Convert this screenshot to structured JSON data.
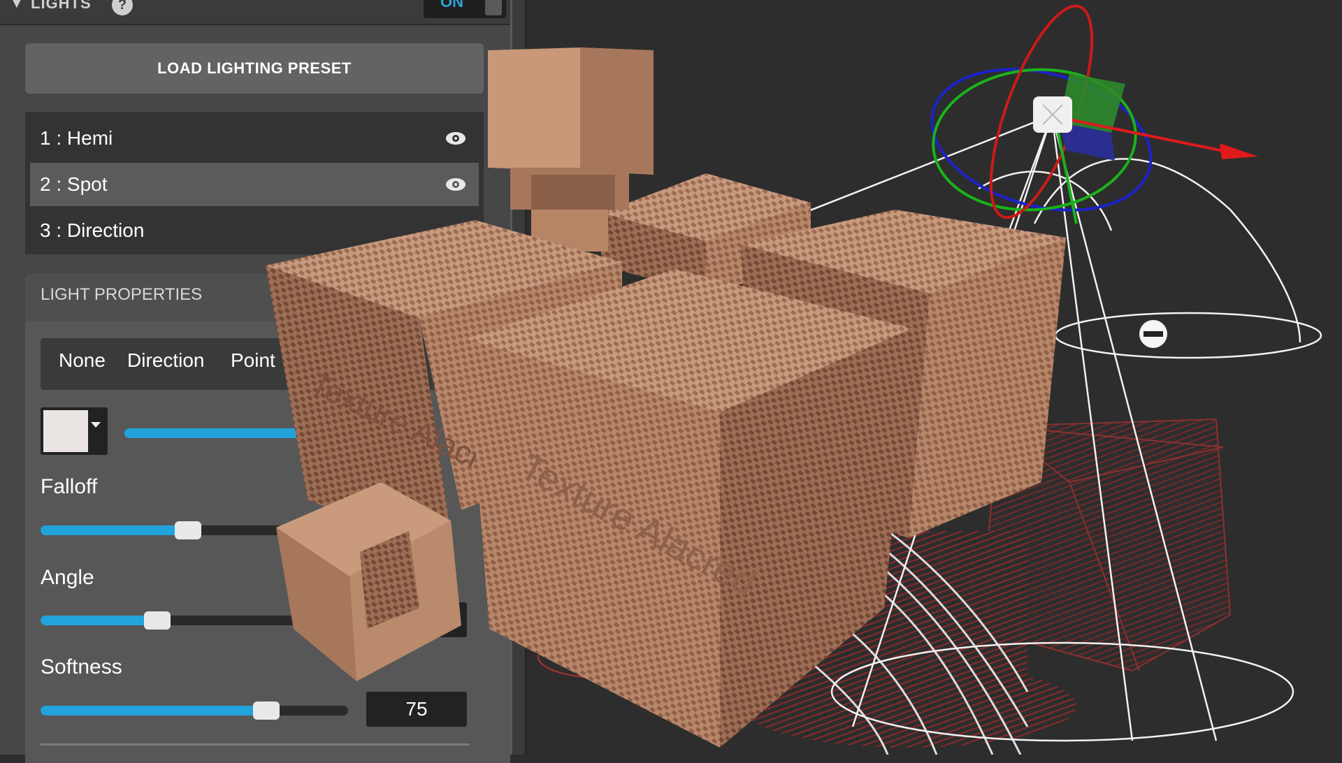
{
  "panel": {
    "header": {
      "title": "LIGHTS",
      "help": "?",
      "toggle": "ON"
    },
    "preset_button": "LOAD LIGHTING PRESET",
    "lights": [
      {
        "label": "1 : Hemi",
        "visible": true
      },
      {
        "label": "2 : Spot",
        "visible": true
      },
      {
        "label": "3 : Direction",
        "visible": false
      }
    ],
    "properties": {
      "title": "LIGHT PROPERTIES",
      "types": [
        "None",
        "Direction",
        "Point"
      ],
      "color": "#ebe6e4",
      "sliders": [
        {
          "label": "Falloff",
          "value_fraction": 0.48
        },
        {
          "label": "Angle",
          "value_fraction": 0.38
        },
        {
          "label": "Softness",
          "value": "75",
          "value_fraction": 0.72
        }
      ]
    }
  },
  "accent_color": "#22a3dc",
  "cube_labels": [
    "Texture Alacred"
  ]
}
